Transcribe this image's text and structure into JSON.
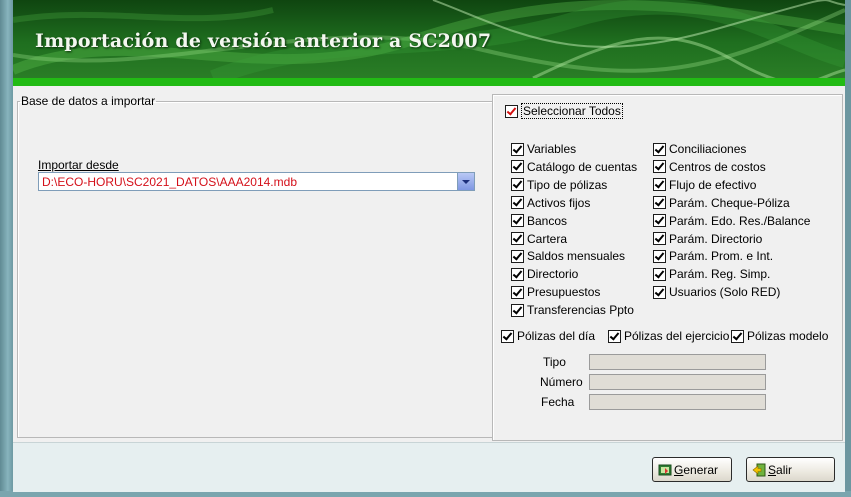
{
  "window": {
    "title": "Importación de versión anterior a SC2007"
  },
  "db_group": {
    "legend": "Base de datos a importar",
    "import_label": "Importar desde",
    "import_value": "D:\\ECO-HORU\\SC2021_DATOS\\AAA2014.mdb"
  },
  "options": {
    "select_all": {
      "label": "Seleccionar Todos",
      "checked": true
    },
    "left_items": [
      {
        "label": "Variables",
        "checked": true
      },
      {
        "label": "Catálogo de cuentas",
        "checked": true
      },
      {
        "label": "Tipo de pólizas",
        "checked": true
      },
      {
        "label": "Activos fijos",
        "checked": true
      },
      {
        "label": "Bancos",
        "checked": true
      },
      {
        "label": "Cartera",
        "checked": true
      },
      {
        "label": "Saldos mensuales",
        "checked": true
      },
      {
        "label": "Directorio",
        "checked": true
      },
      {
        "label": "Presupuestos",
        "checked": true
      },
      {
        "label": "Transferencias Ppto",
        "checked": true
      }
    ],
    "right_items": [
      {
        "label": "Conciliaciones",
        "checked": true
      },
      {
        "label": "Centros de costos",
        "checked": true
      },
      {
        "label": "Flujo de efectivo",
        "checked": true
      },
      {
        "label": "Parám. Cheque-Póliza",
        "checked": true
      },
      {
        "label": "Parám. Edo. Res./Balance",
        "checked": true
      },
      {
        "label": "Parám. Directorio",
        "checked": true
      },
      {
        "label": "Parám. Prom. e Int.",
        "checked": true
      },
      {
        "label": "Parám. Reg. Simp.",
        "checked": true
      },
      {
        "label": "Usuarios (Solo RED)",
        "checked": true
      }
    ],
    "polizas": [
      {
        "label": "Pólizas del día",
        "checked": true
      },
      {
        "label": "Pólizas del ejercicio",
        "checked": true
      },
      {
        "label": "Pólizas modelo",
        "checked": true
      }
    ],
    "fields": [
      {
        "label": "Tipo",
        "value": ""
      },
      {
        "label": "Número",
        "value": ""
      },
      {
        "label": "Fecha",
        "value": ""
      }
    ]
  },
  "buttons": {
    "generar": {
      "accel": "G",
      "rest": "enerar"
    },
    "salir": {
      "accel": "S",
      "rest": "alir"
    }
  },
  "colors": {
    "banner": "#1f6f1f",
    "accent_strip": "#22bb14",
    "path_text": "#d4101a"
  }
}
